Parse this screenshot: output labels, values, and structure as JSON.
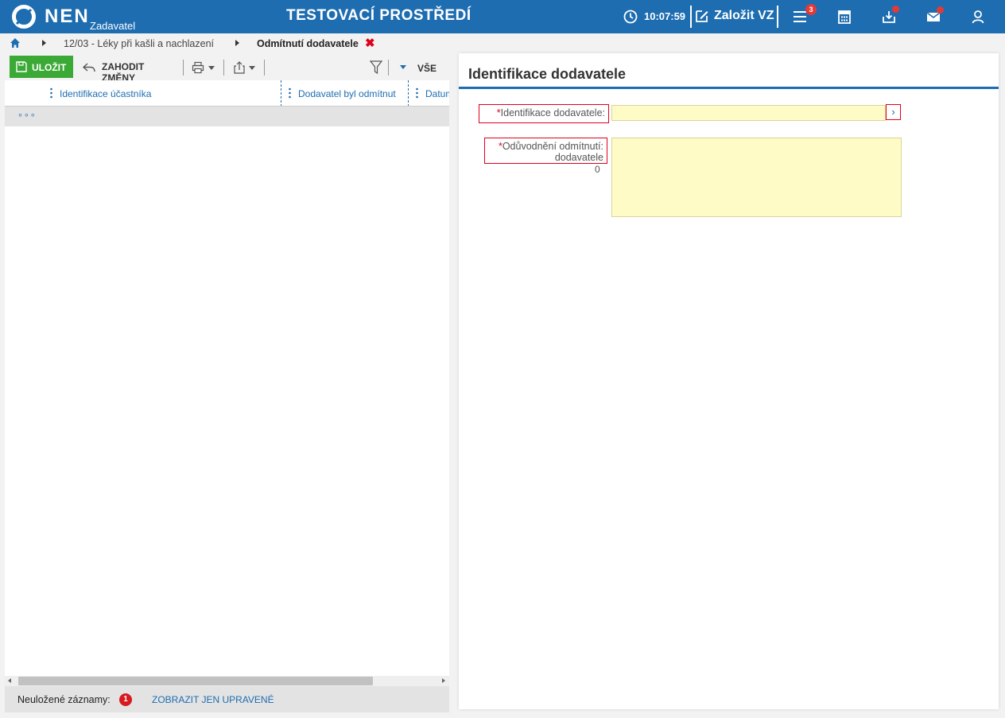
{
  "header": {
    "logo_text": "NEN",
    "logo_subtitle": "Zadavatel",
    "environment_title": "TESTOVACÍ PROSTŘEDÍ",
    "clock_time": "10:07:59",
    "new_vz_label": "Založit VZ",
    "menu_badge_count": "3"
  },
  "breadcrumb": {
    "items": [
      "12/03 - Léky při kašli a nachlazení"
    ],
    "current": "Odmítnutí dodavatele",
    "close_symbol": "✖"
  },
  "toolbar": {
    "save_label": "ULOŽIT",
    "discard_label": "ZAHODIT ZMĚNY",
    "filter_all_label": "VŠE"
  },
  "grid": {
    "columns": [
      "Identifikace účastníka",
      "Dodavatel byl odmítnut",
      "Datum"
    ],
    "row_more": "∘∘∘"
  },
  "statusbar": {
    "unsaved_label": "Neuložené záznamy:",
    "unsaved_count": "1",
    "show_only_modified": "ZOBRAZIT JEN UPRAVENÉ"
  },
  "detail": {
    "title": "Identifikace dodavatele",
    "required_mark": "*",
    "supplier_id_label": "Identifikace dodavatele:",
    "supplier_id_value": "",
    "reason_label_line1": "Odůvodnění odmítnutí:",
    "reason_label_line2": "dodavatele",
    "reason_value": "",
    "reason_char_count": "0",
    "lookup_symbol": "›"
  },
  "colors": {
    "brand_blue": "#1e6db0",
    "save_green": "#3aa935",
    "required_red": "#e0001b",
    "input_yellow": "#fffbc6"
  }
}
